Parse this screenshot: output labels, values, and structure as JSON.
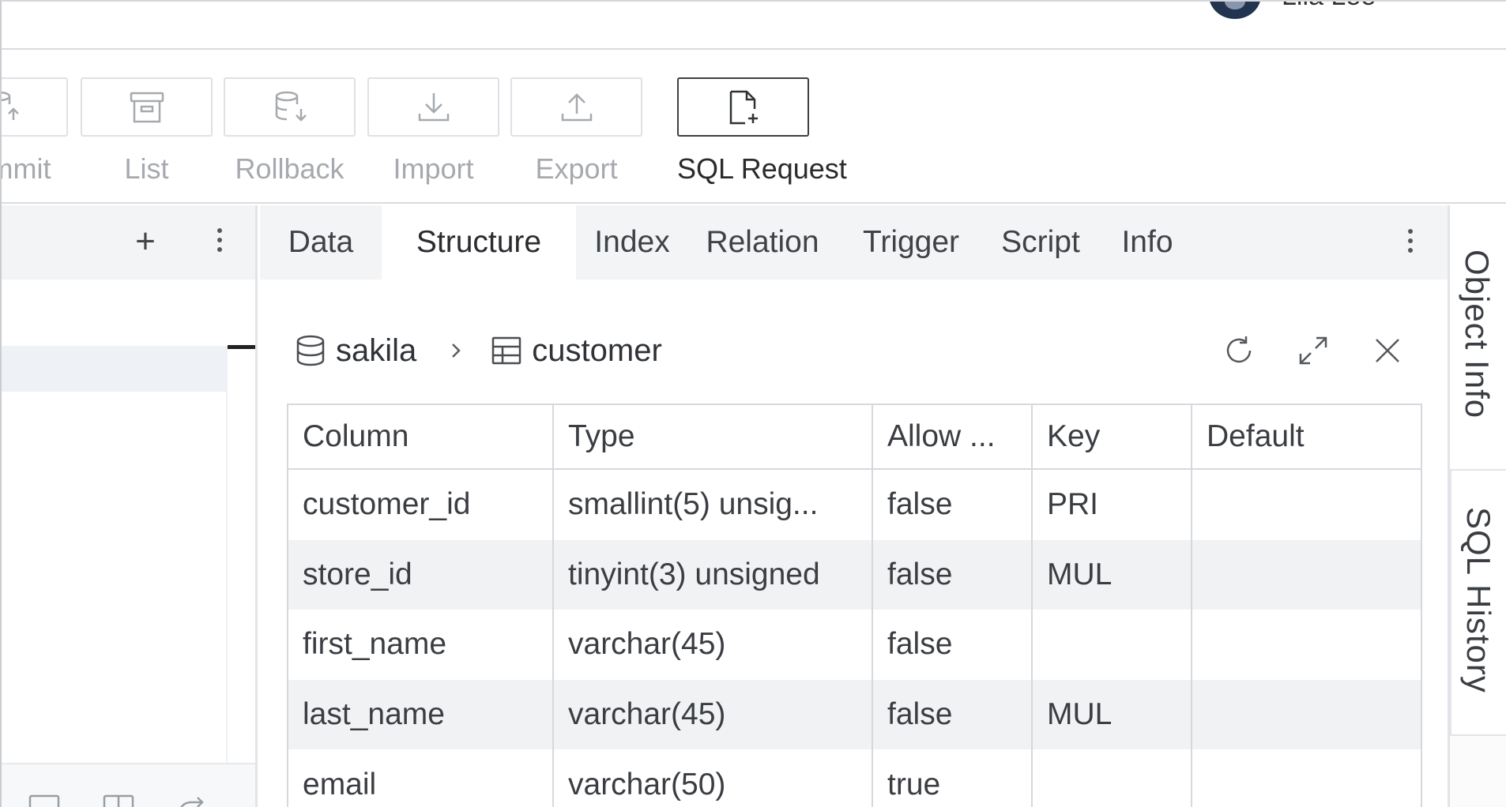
{
  "user": {
    "name": "Lila Lee"
  },
  "toolbar": {
    "commit_label": "Commit",
    "list_label": "List",
    "rollback_label": "Rollback",
    "import_label": "Import",
    "export_label": "Export",
    "sql_request_label": "SQL Request"
  },
  "left_panel": {
    "add_icon": "plus-icon",
    "menu_icon": "kebab-menu-icon"
  },
  "tabs": [
    {
      "label": "Data"
    },
    {
      "label": "Structure",
      "active": true
    },
    {
      "label": "Index"
    },
    {
      "label": "Relation"
    },
    {
      "label": "Trigger"
    },
    {
      "label": "Script"
    },
    {
      "label": "Info"
    }
  ],
  "side_rail": {
    "object_info_label": "Object Info",
    "sql_history_label": "SQL History"
  },
  "breadcrumb": {
    "database": "sakila",
    "table": "customer"
  },
  "structure_table": {
    "columns": [
      "Column",
      "Type",
      "Allow ...",
      "Key",
      "Default"
    ],
    "rows": [
      {
        "column": "customer_id",
        "type": "smallint(5) unsig...",
        "allow_null": "false",
        "key": "PRI",
        "default": ""
      },
      {
        "column": "store_id",
        "type": "tinyint(3) unsigned",
        "allow_null": "false",
        "key": "MUL",
        "default": ""
      },
      {
        "column": "first_name",
        "type": "varchar(45)",
        "allow_null": "false",
        "key": "",
        "default": ""
      },
      {
        "column": "last_name",
        "type": "varchar(45)",
        "allow_null": "false",
        "key": "MUL",
        "default": ""
      },
      {
        "column": "email",
        "type": "varchar(50)",
        "allow_null": "true",
        "key": "",
        "default": ""
      }
    ]
  },
  "colors": {
    "active_border": "#3d3f43",
    "disabled_text": "#a6a9ae",
    "tab_bar_bg": "#f3f4f6",
    "row_alt_bg": "#f1f2f4"
  }
}
